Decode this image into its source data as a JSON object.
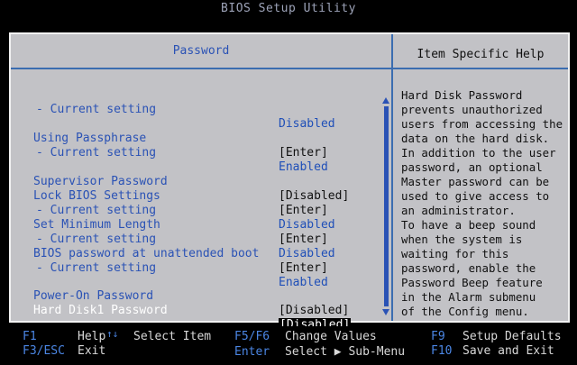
{
  "app": {
    "title": "BIOS Setup Utility"
  },
  "panel": {
    "title": "Password"
  },
  "help": {
    "title": "Item Specific Help",
    "lines": [
      "Hard Disk Password",
      "prevents unauthorized",
      "users from accessing the",
      "data on the hard disk.",
      "In addition to the user",
      "password, an optional",
      "Master password can be",
      "used to give access to",
      "an administrator.",
      "To have a beep sound",
      "when the system is",
      "waiting for this",
      "password, enable the",
      "Password Beep feature",
      "in the Alarm submenu",
      "of the Config menu."
    ]
  },
  "settings": [
    {
      "label": "- Current setting",
      "value": "Disabled"
    },
    {
      "label": "Using Passphrase",
      "value": "[Enter]"
    },
    {
      "label": "- Current setting",
      "value": "Enabled"
    },
    {
      "label": "Supervisor Password",
      "value": "[Disabled]"
    },
    {
      "label": "Lock BIOS Settings",
      "value": "[Enter]"
    },
    {
      "label": "- Current setting",
      "value": "Disabled"
    },
    {
      "label": "Set Minimum Length",
      "value": "[Enter]"
    },
    {
      "label": "- Current setting",
      "value": "Disabled"
    },
    {
      "label": "BIOS password at unattended boot",
      "value": "[Enter]"
    },
    {
      "label": "- Current setting",
      "value": "Enabled"
    },
    {
      "label": "Power-On Password",
      "value": "[Disabled]"
    },
    {
      "label": "Hard Disk1 Password",
      "value": "[Disabled]"
    }
  ],
  "footer": {
    "f1_key": "F1",
    "f1_desc": "Help",
    "arrows_key": "↑↓",
    "arrows_desc": "Select Item",
    "f5f6_key": "F5/F6",
    "f5f6_desc": "Change Values",
    "f9_key": "F9",
    "f9_desc": "Setup Defaults",
    "esc_key": "F3/ESC",
    "esc_desc": "Exit",
    "enter_key": "Enter",
    "enter_desc": "Select ▶ Sub-Menu",
    "f10_key": "F10",
    "f10_desc": "Save and Exit"
  },
  "colors": {
    "accent": "#2a52b5",
    "panel_bg": "#c2c2c6",
    "footer_key": "#4b86e4"
  }
}
